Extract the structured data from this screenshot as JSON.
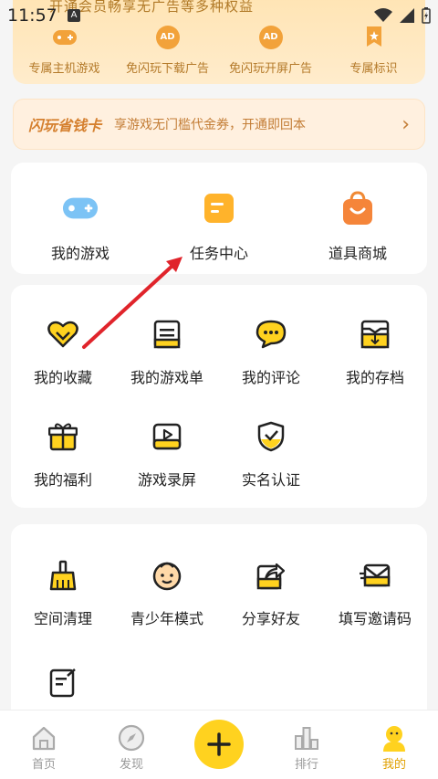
{
  "status": {
    "time": "11:57",
    "indicator": "A"
  },
  "banner": {
    "subtitle": "开通会员畅享无广告等多种权益",
    "perks": [
      {
        "label": "专属主机游戏",
        "icon": "gamepad-icon"
      },
      {
        "label": "免闪玩下载广告",
        "icon": "ad-icon",
        "icon_text": "AD"
      },
      {
        "label": "免闪玩开屏广告",
        "icon": "ad-icon",
        "icon_text": "AD"
      },
      {
        "label": "专属标识",
        "icon": "badge-icon"
      }
    ]
  },
  "money_card": {
    "title": "闪玩省钱卡",
    "desc": "享游戏无门槛代金券，开通即回本",
    "arrow": "›"
  },
  "quick": [
    {
      "label": "我的游戏",
      "icon": "gamepad-icon"
    },
    {
      "label": "任务中心",
      "icon": "task-icon"
    },
    {
      "label": "道具商城",
      "icon": "shopping-bag-icon"
    }
  ],
  "section2": [
    {
      "label": "我的收藏",
      "icon": "heart-icon"
    },
    {
      "label": "我的游戏单",
      "icon": "list-icon"
    },
    {
      "label": "我的评论",
      "icon": "comment-icon"
    },
    {
      "label": "我的存档",
      "icon": "archive-icon"
    },
    {
      "label": "我的福利",
      "icon": "gift-icon"
    },
    {
      "label": "游戏录屏",
      "icon": "play-icon"
    },
    {
      "label": "实名认证",
      "icon": "shield-icon"
    }
  ],
  "section3": [
    {
      "label": "空间清理",
      "icon": "broom-icon"
    },
    {
      "label": "青少年模式",
      "icon": "child-icon"
    },
    {
      "label": "分享好友",
      "icon": "share-icon"
    },
    {
      "label": "填写邀请码",
      "icon": "mail-icon"
    }
  ],
  "nav": [
    {
      "label": "首页",
      "icon": "home-icon"
    },
    {
      "label": "发现",
      "icon": "compass-icon"
    },
    {
      "label": "",
      "icon": "plus-icon"
    },
    {
      "label": "排行",
      "icon": "rank-icon"
    },
    {
      "label": "我的",
      "icon": "profile-icon"
    }
  ],
  "colors": {
    "accent": "#ffd21f",
    "orange": "#f2a23a",
    "active": "#e0a000",
    "annotation": "#e0242b"
  }
}
